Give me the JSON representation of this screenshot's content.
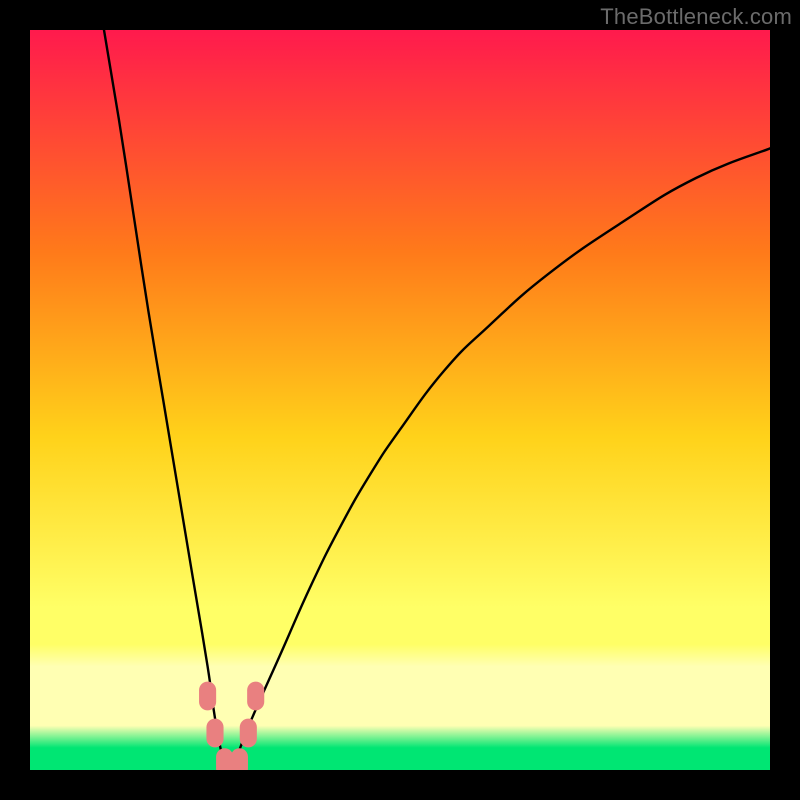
{
  "watermark": "TheBottleneck.com",
  "chart_data": {
    "type": "line",
    "title": "",
    "xlabel": "",
    "ylabel": "",
    "xlim": [
      0,
      100
    ],
    "ylim": [
      0,
      100
    ],
    "grid": false,
    "background_gradient": {
      "top": "#ff1a4d",
      "mid_upper": "#ff7a1a",
      "mid": "#ffd21a",
      "mid_lower": "#ffff66",
      "band_pale": "#ffffb3",
      "bottom": "#00e673"
    },
    "series": [
      {
        "name": "bottleneck-curve",
        "color": "#000000",
        "x": [
          10,
          12,
          14,
          16,
          18,
          20,
          22,
          24,
          25,
          26,
          27,
          28,
          30,
          34,
          38,
          42,
          46,
          50,
          56,
          62,
          70,
          80,
          90,
          100
        ],
        "y": [
          100,
          88,
          75,
          62,
          50,
          38,
          26,
          14,
          7,
          2,
          0,
          2,
          7,
          16,
          25,
          33,
          40,
          46,
          54,
          60,
          67,
          74,
          80,
          84
        ]
      }
    ],
    "markers": [
      {
        "name": "marker-left-upper",
        "x": 24.0,
        "y": 10.0,
        "color": "#e98080"
      },
      {
        "name": "marker-left-lower",
        "x": 25.0,
        "y": 5.0,
        "color": "#e98080"
      },
      {
        "name": "marker-bottom-left",
        "x": 26.3,
        "y": 1.0,
        "color": "#e98080"
      },
      {
        "name": "marker-bottom-right",
        "x": 28.3,
        "y": 1.0,
        "color": "#e98080"
      },
      {
        "name": "marker-right-lower",
        "x": 29.5,
        "y": 5.0,
        "color": "#e98080"
      },
      {
        "name": "marker-right-upper",
        "x": 30.5,
        "y": 10.0,
        "color": "#e98080"
      }
    ],
    "marker_size_px": 18
  }
}
